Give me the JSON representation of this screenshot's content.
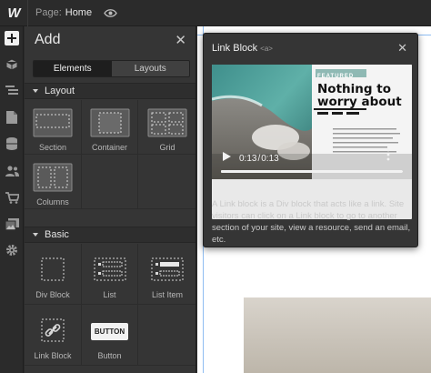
{
  "topbar": {
    "page_label": "Page:",
    "page_name": "Home"
  },
  "panel": {
    "title": "Add",
    "tabs": [
      "Elements",
      "Layouts"
    ],
    "sections": [
      {
        "name": "Layout",
        "items": [
          "Section",
          "Container",
          "Grid",
          "Columns"
        ]
      },
      {
        "name": "Basic",
        "items": [
          "Div Block",
          "List",
          "List Item",
          "Link Block",
          "Button"
        ]
      }
    ],
    "button_icon_text": "BUTTON"
  },
  "tooltip": {
    "title": "Link Block",
    "tag": "<a>",
    "video": {
      "headline": "Nothing to worry about",
      "badge": "FEATURED",
      "current_time": "0:13",
      "total_time": "0:13",
      "progress": 1.0
    },
    "description": "A Link block is a Div block that acts like a link. Site visitors can click on a Link block to go to another section of your site, view a resource, send an email, etc."
  },
  "colors": {
    "canvas_guide": "#8fbdf2",
    "panel_bg": "#353535",
    "teal_badge": "#8fb9b4"
  }
}
